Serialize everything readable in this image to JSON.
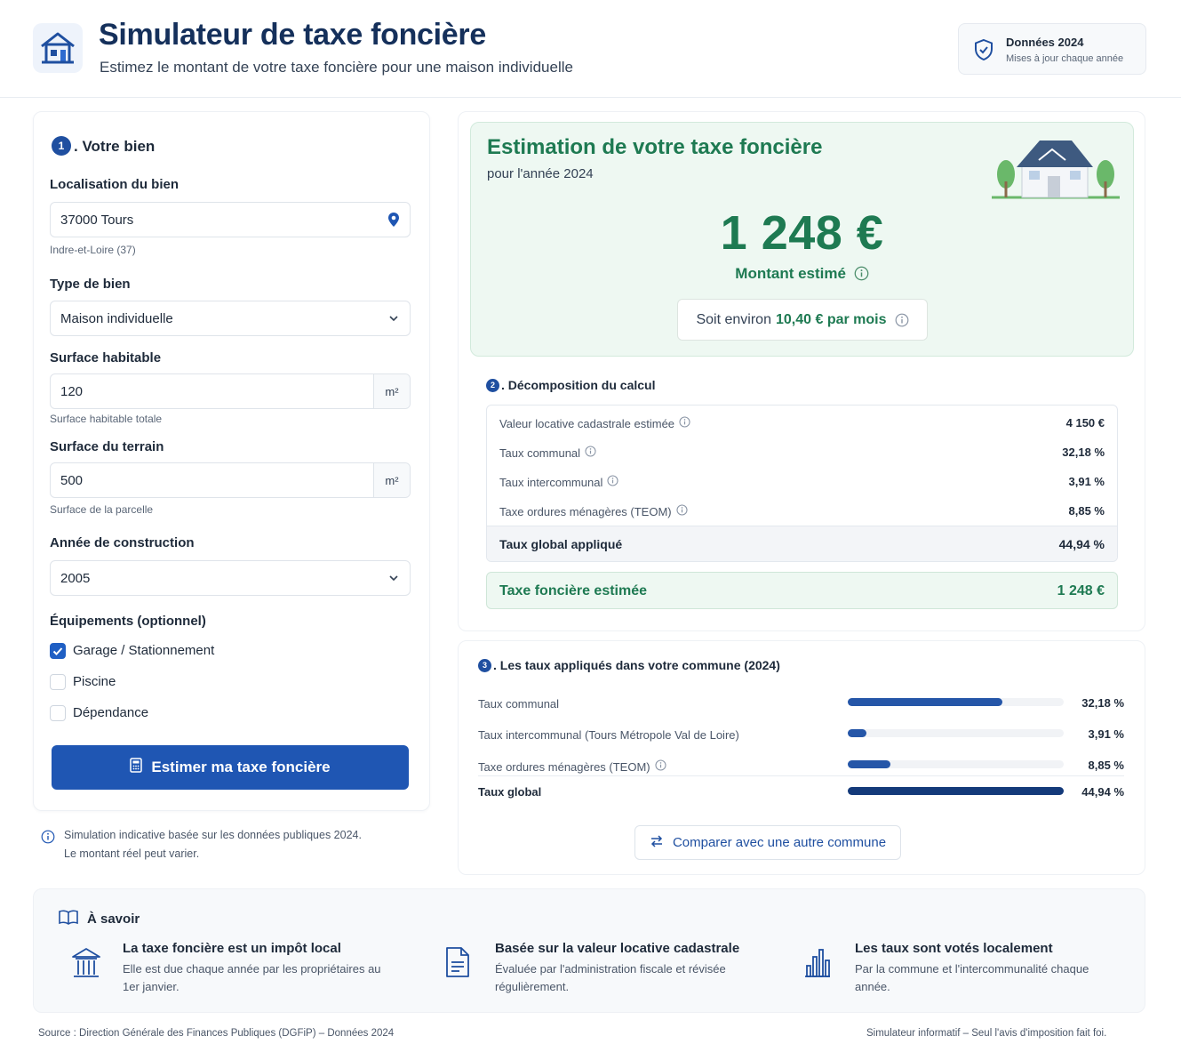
{
  "header": {
    "title": "Simulateur de taxe foncière",
    "subtitle": "Estimez le montant de votre taxe foncière pour une maison individuelle",
    "badge_title": "Données 2024",
    "badge_sub": "Mises à jour chaque année"
  },
  "form": {
    "step_number": "1",
    "section_title": ". Votre bien",
    "location_label": "Localisation du bien",
    "location_value": "37000 Tours",
    "location_hint": "Indre-et-Loire (37)",
    "type_label": "Type de bien",
    "type_value": "Maison individuelle",
    "surface_label": "Surface habitable",
    "surface_value": "120",
    "surface_unit": "m²",
    "surface_hint": "Surface habitable totale",
    "land_label": "Surface du terrain",
    "land_value": "500",
    "land_unit": "m²",
    "land_hint": "Surface de la parcelle",
    "year_label": "Année de construction",
    "year_value": "2005",
    "equip_label": "Équipements (optionnel)",
    "equipments": [
      {
        "label": "Garage / Stationnement",
        "checked": true
      },
      {
        "label": "Piscine",
        "checked": false
      },
      {
        "label": "Dépendance",
        "checked": false
      }
    ],
    "submit_label": "Estimer ma taxe foncière",
    "note_line1": "Simulation indicative basée sur les données publiques 2024.",
    "note_line2": "Le montant réel peut varier."
  },
  "estimate": {
    "title": "Estimation de votre taxe foncière",
    "subtitle": "pour l'année 2024",
    "amount": "1 248 €",
    "amount_label": "Montant estimé",
    "monthly_prefix": "Soit environ",
    "monthly_value": "10,40 € par mois"
  },
  "breakdown": {
    "step_number": "2",
    "title": ". Décomposition du calcul",
    "rows": [
      {
        "label": "Valeur locative cadastrale estimée",
        "value": "4 150 €"
      },
      {
        "label": "Taux communal",
        "value": "32,18 %"
      },
      {
        "label": "Taux intercommunal",
        "value": "3,91 %"
      },
      {
        "label": "Taxe ordures ménagères (TEOM)",
        "value": "8,85 %"
      }
    ],
    "total_label": "Taux global appliqué",
    "total_value": "44,94 %",
    "tax_label": "Taxe foncière estimée",
    "tax_value": "1 248 €"
  },
  "rates": {
    "step_number": "3",
    "title": ". Les taux appliqués dans votre commune (2024)",
    "rows": [
      {
        "label": "Taux communal",
        "value": "32,18 %",
        "percent": 32.18
      },
      {
        "label": "Taux intercommunal (Tours Métropole Val de Loire)",
        "value": "3,91 %",
        "percent": 3.91
      },
      {
        "label": "Taxe ordures ménagères (TEOM)",
        "value": "8,85 %",
        "percent": 8.85
      }
    ],
    "global_label": "Taux global",
    "global_value": "44,94 %",
    "global_percent": 44.94,
    "compare_label": "Comparer avec une autre commune"
  },
  "know": {
    "title": "À savoir",
    "items": [
      {
        "title": "La taxe foncière est un impôt local",
        "desc": "Elle est due chaque année par les propriétaires au 1er janvier."
      },
      {
        "title": "Basée sur la valeur locative cadastrale",
        "desc": "Évaluée par l'administration fiscale et révisée régulièrement."
      },
      {
        "title": "Les taux sont votés localement",
        "desc": "Par la commune et l'intercommunalité chaque année."
      }
    ]
  },
  "footer": {
    "source": "Source : Direction Générale des Finances Publiques (DGFiP) – Données 2024",
    "disclaimer": "Simulateur informatif – Seul l'avis d'imposition fait foi."
  },
  "colors": {
    "primary": "#1f56b3",
    "navy": "#15305b",
    "green": "#1e7a52",
    "green_bg": "#eef8f2"
  }
}
